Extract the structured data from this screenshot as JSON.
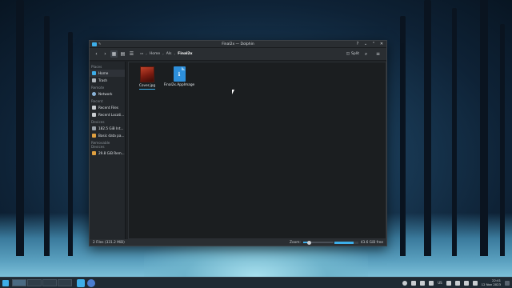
{
  "window": {
    "title": "Final2x — Dolphin"
  },
  "toolbar": {
    "back_icon": "chevron-left-icon",
    "forward_icon": "chevron-right-icon",
    "breadcrumbs": [
      "Home",
      "AIs",
      "Final2x"
    ],
    "split_label": "Split"
  },
  "places": {
    "sections": [
      {
        "title": "Places",
        "items": [
          "Home",
          "Trash"
        ]
      },
      {
        "title": "Remote",
        "items": [
          "Network"
        ]
      },
      {
        "title": "Recent",
        "items": [
          "Recent Files",
          "Recent Locati..."
        ]
      },
      {
        "title": "Devices",
        "items": [
          "182.5 GiB Int...",
          "Basic data pa..."
        ]
      },
      {
        "title": "Removable Devices",
        "items": [
          "29.8 GiB Rem..."
        ]
      }
    ]
  },
  "files": [
    {
      "name": "Cover.jpg",
      "type": "image"
    },
    {
      "name": "Final2x.AppImage",
      "type": "appimage"
    }
  ],
  "statusbar": {
    "summary": "2 Files (331.2 MiB)",
    "zoom_label": "Zoom:",
    "zoom_level": 0.2,
    "free_space": "43.6 GiB free",
    "used_fraction": 0.82
  },
  "taskbar": {
    "time": "22:41",
    "date": "12 Nov 2023",
    "locale": "US"
  },
  "colors": {
    "accent": "#3daee9",
    "window_bg": "#1e2124"
  }
}
